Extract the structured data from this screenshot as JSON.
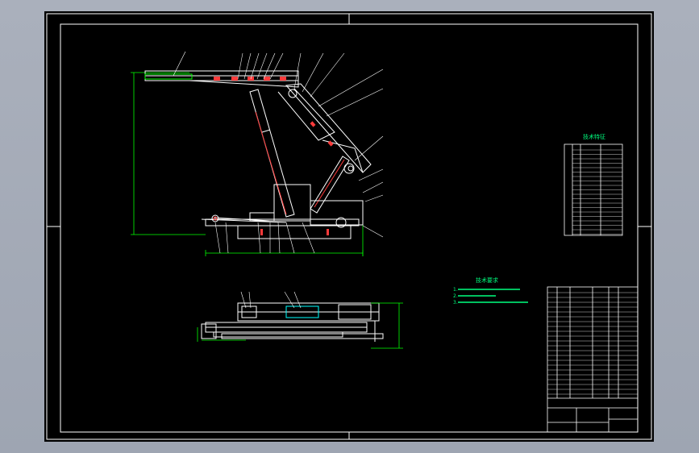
{
  "colors": {
    "background": "#000000",
    "viewport": "#a7adb9",
    "frame": "#ffffff",
    "dimension": "#00ff00",
    "structure": "#ffffff",
    "section_fill": "#ff3b3b",
    "highlight": "#00ffff",
    "notes_text": "#00ff7f"
  },
  "notes": {
    "title": "技术要求",
    "lines": [
      "1.",
      "2.",
      "3."
    ]
  },
  "params_table": {
    "title": "技术特征"
  },
  "title_block": {
    "name": "",
    "sheet": ""
  }
}
